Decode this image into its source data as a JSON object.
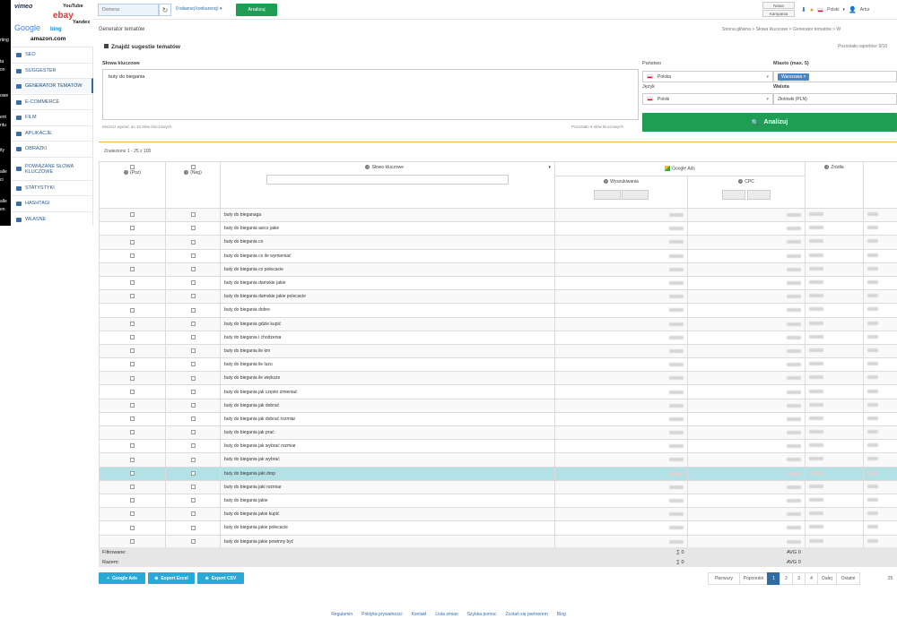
{
  "left_strip": [
    "rting",
    "ta",
    "on",
    "owe",
    "ent",
    "ntu",
    "ity",
    "alle",
    "ci",
    "alle",
    "en"
  ],
  "logos": [
    "vimeo",
    "YouTube",
    "ebay",
    "Google",
    "bing",
    "Yandex",
    "amazon.com"
  ],
  "sidebar": {
    "items": [
      {
        "label": "SEO"
      },
      {
        "label": "SUGGESTER"
      },
      {
        "label": "GENERATOR TEMATÓW",
        "active": true
      },
      {
        "label": "E-COMMERCE"
      },
      {
        "label": "FILM"
      },
      {
        "label": "APLIKACJE"
      },
      {
        "label": "OBRAZKI"
      },
      {
        "label": "POWIĄZANE SŁOWA KLUCZOWE"
      },
      {
        "label": "STATYSTYKI"
      },
      {
        "label": "HASHTAGI"
      },
      {
        "label": "WŁASNE"
      }
    ]
  },
  "topbar": {
    "domain_placeholder": "Domena",
    "competitors_label": "0 własnej konkurencji ▾",
    "analyze_label": "Analizuj",
    "btn_new": "Nowa",
    "btn_campaign": "Kampania",
    "language": "Polski",
    "user": "Artur"
  },
  "main": {
    "page_title": "Generator tematów",
    "breadcrumb": "Strona główna  >  Słowa kluczowe  >  Generator tematów  >  W",
    "section_title": "Znajdź sugestie tematów",
    "reports_left": "Pozostało raportów: 9/10"
  },
  "form": {
    "keywords_label": "Słowa kluczowe",
    "keywords_value": "buty do biegania",
    "hint_left": "Możesz wpisać do 10 słów kluczowych.",
    "hint_right": "Pozostało 9 słów kluczowych",
    "country_label": "Państwo",
    "country_value": "Polska",
    "city_label": "Miasto (max. 5)",
    "city_tag": "Warszawa ×",
    "language_label": "Język",
    "language_value": "Polski",
    "currency_label": "Waluta",
    "currency_value": "Złotówki (PLN)",
    "analyze_label": "Analizuj"
  },
  "results": {
    "found_text": "Znaleziono 1 - 25 z 100",
    "headers": {
      "pos": "(Poz)",
      "neg": "(Neg)",
      "keyword": "Słowo kluczowe",
      "google_ads": "Google Ads",
      "searches": "Wyszukiwania",
      "cpc": "CPC",
      "source": "Źródła"
    },
    "rows": [
      "buty do bieganaga",
      "buty do biegania asics jakie",
      "buty do biegania co",
      "buty do biegania co ile wymieniać",
      "buty do biegania co polecacie",
      "buty do biegania damskie jakie",
      "buty do biegania damskie jakie polecacie",
      "buty do biegania dobre",
      "buty do biegania gdzie kupić",
      "buty do biegania i chodzenia",
      "buty do biegania ile km",
      "buty do biegania ile luzu",
      "buty do biegania ile większe",
      "buty do biegania jak często zmieniać",
      "buty do biegania jak dobrać",
      "buty do biegania jak dobrać rozmiar",
      "buty do biegania jak prać",
      "buty do biegania jak wybrać rozmiar",
      "buty do biegania jak wybrać",
      "buty do biegania jaki drop",
      "buty do biegania jaki rozmiar",
      "buty do biegania jakie",
      "buty do biegania jakie kupić",
      "buty do biegania jakie polecacie",
      "buty do biegania jakie powinny być"
    ],
    "highlight_index": 19
  },
  "summary": {
    "filtered_label": "Filtrowane:",
    "total_label": "Razem:",
    "sum_filtered": "∑ 0",
    "sum_total": "∑ 0",
    "avg_filtered": "AVG 0",
    "avg_total": "AVG 0"
  },
  "exports": [
    "Google Ads",
    "Export Excel",
    "Export CSV"
  ],
  "pager": [
    "Pierwszy",
    "Poprzedni",
    "1",
    "2",
    "3",
    "4",
    "Dalej",
    "Ostatni"
  ],
  "per_page": "25",
  "footer": [
    "Regulamin",
    "Polityka prywatności",
    "Kontakt",
    "Lista zmian",
    "Szybka pomoc",
    "Zostań się partnerem",
    "Blog"
  ]
}
